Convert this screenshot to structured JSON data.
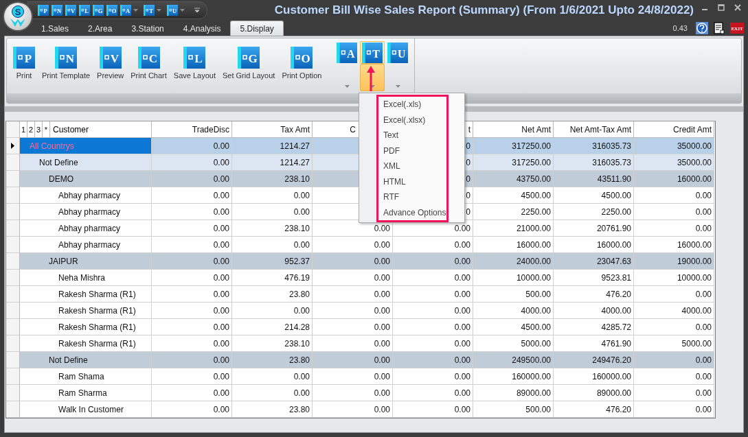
{
  "window": {
    "title": "Customer Bill Wise Sales Report (Summary) (From 1/6/2021 Upto 24/8/2022)",
    "logo_letter": "S"
  },
  "quick_access": [
    {
      "letter": "P",
      "kind": "plain"
    },
    {
      "letter": "N",
      "kind": "plain"
    },
    {
      "letter": "V",
      "kind": "plain"
    },
    {
      "letter": "L",
      "kind": "plain"
    },
    {
      "letter": "G",
      "kind": "plain"
    },
    {
      "letter": "O",
      "kind": "plain"
    },
    {
      "letter": "A",
      "kind": "split"
    },
    {
      "letter": "T",
      "kind": "split"
    },
    {
      "letter": "U",
      "kind": "split"
    }
  ],
  "tabs": [
    {
      "label": "1.Sales",
      "selected": false
    },
    {
      "label": "2.Area",
      "selected": false
    },
    {
      "label": "3.Station",
      "selected": false
    },
    {
      "label": "4.Analysis",
      "selected": false
    },
    {
      "label": "5.Display",
      "selected": true
    }
  ],
  "status": {
    "version": "0.43",
    "exit_label": "EXIT"
  },
  "ribbon": {
    "buttons": [
      {
        "kind": "large",
        "letter": "P",
        "label": "Print"
      },
      {
        "kind": "large",
        "letter": "N",
        "label": "Print Template"
      },
      {
        "kind": "large",
        "letter": "V",
        "label": "Preview"
      },
      {
        "kind": "large",
        "letter": "C",
        "label": "Print Chart"
      },
      {
        "kind": "large",
        "letter": "L",
        "label": "Save Layout"
      },
      {
        "kind": "large",
        "letter": "G",
        "label": "Set Grid Layout"
      },
      {
        "kind": "large",
        "letter": "O",
        "label": "Print Option"
      },
      {
        "kind": "split",
        "letter": "A",
        "highlighted": false
      },
      {
        "kind": "split",
        "letter": "T",
        "highlighted": true
      },
      {
        "kind": "split",
        "letter": "U",
        "highlighted": false
      }
    ]
  },
  "export_menu": {
    "items": [
      "Excel(.xls)",
      "Excel(.xlsx)",
      "Text",
      "PDF",
      "XML",
      "HTML",
      "RTF",
      "Advance Options"
    ]
  },
  "table": {
    "levels": [
      "1",
      "2",
      "3",
      "*"
    ],
    "columns": [
      "Customer",
      "TradeDisc",
      "Tax Amt",
      "C",
      "t",
      "Net Amt",
      "Net Amt-Tax Amt",
      "Credit Amt"
    ],
    "rows": [
      {
        "cells": [
          "All Countrys",
          "0.00",
          "1214.27",
          null,
          "0",
          "317250.00",
          "316035.73",
          "35000.00"
        ],
        "selected": true,
        "children": [
          {
            "cells": [
              "Not Define",
              "0.00",
              "1214.27",
              null,
              "0",
              "317250.00",
              "316035.73",
              "35000.00"
            ],
            "selected": false,
            "children": [
              {
                "cells": [
                  "DEMO",
                  "0.00",
                  "238.10",
                  null,
                  "0",
                  "43750.00",
                  "43511.90",
                  "16000.00"
                ],
                "selected": false,
                "children": [
                  {
                    "cells": [
                      "Abhay pharmacy",
                      "0.00",
                      "0.00",
                      null,
                      "0",
                      "4500.00",
                      "4500.00",
                      "0.00"
                    ],
                    "selected": false
                  },
                  {
                    "cells": [
                      "Abhay pharmacy",
                      "0.00",
                      "0.00",
                      null,
                      "0",
                      "2250.00",
                      "2250.00",
                      "0.00"
                    ],
                    "selected": false
                  },
                  {
                    "cells": [
                      "Abhay pharmacy",
                      "0.00",
                      "238.10",
                      "0.00",
                      "0.00",
                      "21000.00",
                      "20761.90",
                      "0.00"
                    ],
                    "selected": false
                  },
                  {
                    "cells": [
                      "Abhay pharmacy",
                      "0.00",
                      "0.00",
                      "0.00",
                      "0.00",
                      "16000.00",
                      "16000.00",
                      "16000.00"
                    ],
                    "selected": false
                  }
                ]
              },
              {
                "cells": [
                  "JAIPUR",
                  "0.00",
                  "952.37",
                  "0.00",
                  "0.00",
                  "24000.00",
                  "23047.63",
                  "19000.00"
                ],
                "selected": false,
                "children": [
                  {
                    "cells": [
                      "Neha Mishra",
                      "0.00",
                      "476.19",
                      "0.00",
                      "0.00",
                      "10000.00",
                      "9523.81",
                      "10000.00"
                    ],
                    "selected": false
                  },
                  {
                    "cells": [
                      "Rakesh Sharma (R1)",
                      "0.00",
                      "23.80",
                      "0.00",
                      "0.00",
                      "500.00",
                      "476.20",
                      "0.00"
                    ],
                    "selected": false
                  },
                  {
                    "cells": [
                      "Rakesh Sharma (R1)",
                      "0.00",
                      "0.00",
                      "0.00",
                      "0.00",
                      "4000.00",
                      "4000.00",
                      "4000.00"
                    ],
                    "selected": false
                  },
                  {
                    "cells": [
                      "Rakesh Sharma (R1)",
                      "0.00",
                      "214.28",
                      "0.00",
                      "0.00",
                      "4500.00",
                      "4285.72",
                      "0.00"
                    ],
                    "selected": false
                  },
                  {
                    "cells": [
                      "Rakesh Sharma (R1)",
                      "0.00",
                      "238.10",
                      "0.00",
                      "0.00",
                      "5000.00",
                      "4761.90",
                      "5000.00"
                    ],
                    "selected": false
                  }
                ]
              },
              {
                "cells": [
                  "Not Define",
                  "0.00",
                  "23.80",
                  "0.00",
                  "0.00",
                  "249500.00",
                  "249476.20",
                  "0.00"
                ],
                "selected": false,
                "children": [
                  {
                    "cells": [
                      "Ram Shama",
                      "0.00",
                      "0.00",
                      "0.00",
                      "0.00",
                      "160000.00",
                      "160000.00",
                      "0.00"
                    ],
                    "selected": false
                  },
                  {
                    "cells": [
                      "Ram Sharma",
                      "0.00",
                      "0.00",
                      "0.00",
                      "0.00",
                      "89000.00",
                      "89000.00",
                      "0.00"
                    ],
                    "selected": false
                  },
                  {
                    "cells": [
                      "Walk In Customer",
                      "0.00",
                      "23.80",
                      "0.00",
                      "0.00",
                      "500.00",
                      "476.20",
                      "0.00"
                    ],
                    "selected": false
                  }
                ]
              }
            ]
          }
        ]
      }
    ]
  }
}
